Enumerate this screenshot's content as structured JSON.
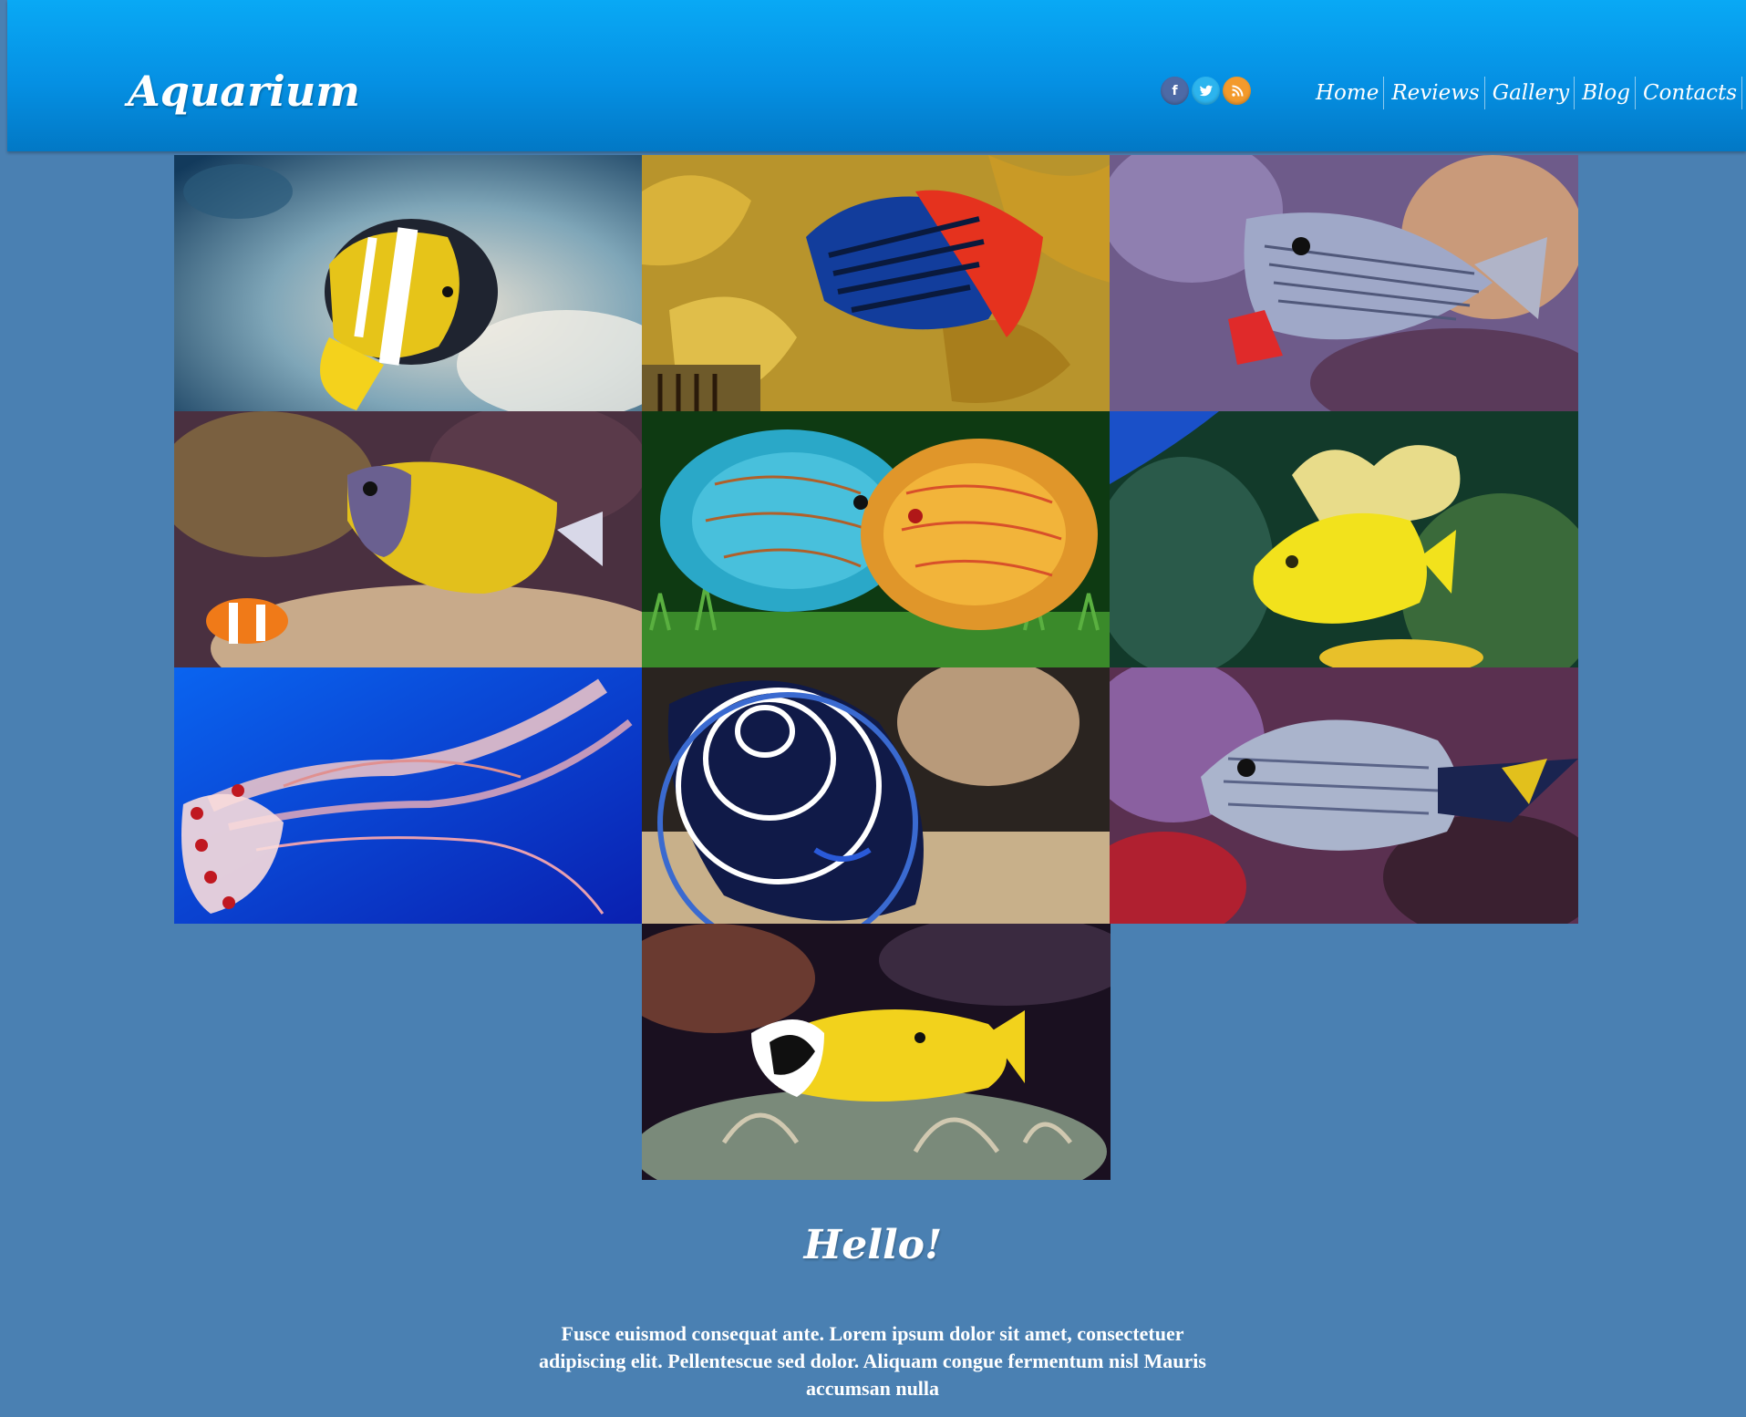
{
  "header": {
    "logo": "Aquarium",
    "social": [
      {
        "name": "facebook-icon",
        "glyph": "f",
        "color": "#4d6aa6"
      },
      {
        "name": "twitter-icon",
        "glyph": "t",
        "color": "#2cb4ee"
      },
      {
        "name": "rss-icon",
        "glyph": "≋",
        "color": "#f39a2c"
      }
    ],
    "nav": [
      "Home",
      "Reviews",
      "Gallery",
      "Blog",
      "Contacts"
    ]
  },
  "gallery": {
    "images": [
      {
        "subject": "clownfish"
      },
      {
        "subject": "butterflyfish"
      },
      {
        "subject": "surgeonfish"
      },
      {
        "subject": "tang-and-clownfish"
      },
      {
        "subject": "discus-pair"
      },
      {
        "subject": "yellow-tang"
      },
      {
        "subject": "jellyfish"
      },
      {
        "subject": "emperor-angelfish"
      },
      {
        "subject": "silver-surgeonfish"
      },
      {
        "subject": "foxface-rabbitfish"
      }
    ]
  },
  "content": {
    "heading": "Hello!",
    "paragraph": "Fusce euismod consequat ante. Lorem ipsum dolor sit amet, consectetuer adipiscing elit. Pellentescue sed dolor. Aliquam congue fermentum nisl Mauris accumsan nulla"
  },
  "colors": {
    "page_background": "#4a80b2",
    "header_top": "#09a9f5",
    "header_bottom": "#0278c5"
  }
}
